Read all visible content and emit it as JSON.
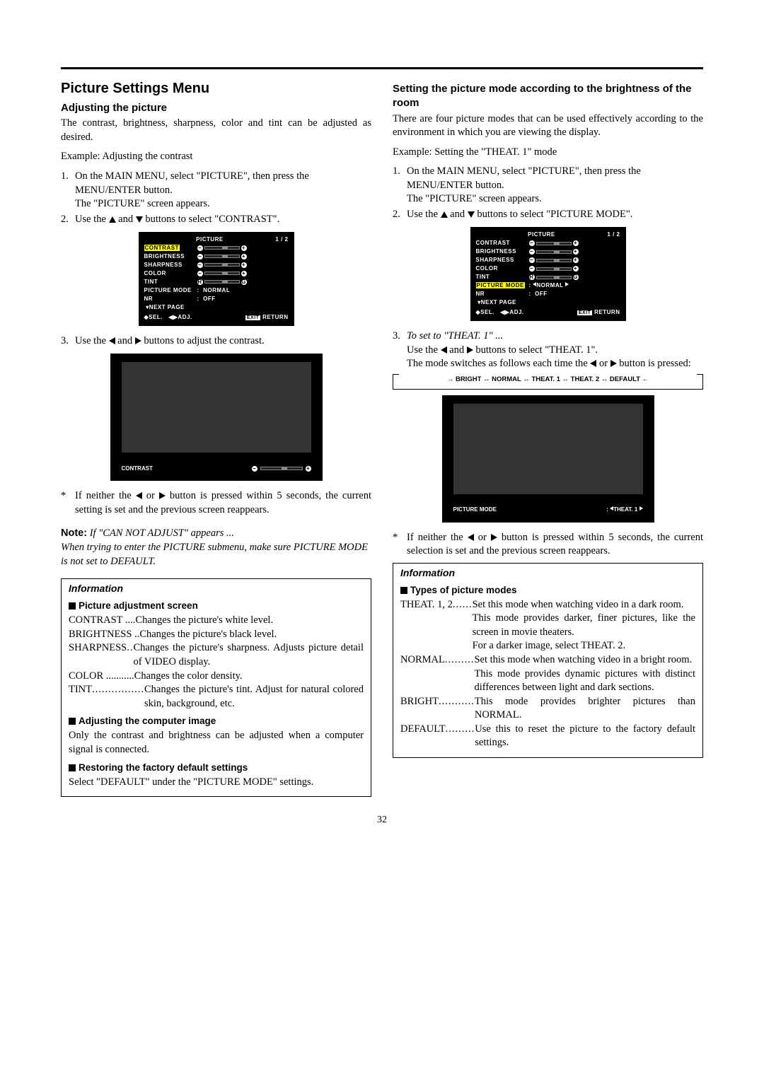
{
  "left": {
    "h1": "Picture Settings Menu",
    "h2": "Adjusting the picture",
    "intro": "The contrast, brightness, sharpness, color and tint can be adjusted as desired.",
    "example": "Example: Adjusting the contrast",
    "step1a": "On the MAIN MENU, select \"PICTURE\", then press the MENU/ENTER button.",
    "step1b": "The \"PICTURE\" screen appears.",
    "step2a": "Use the ",
    "step2b": " and ",
    "step2c": " buttons to select \"CONTRAST\".",
    "step3a": "Use the ",
    "step3b": " and ",
    "step3c": " buttons to adjust the contrast.",
    "asterisk": "If neither the ",
    "asterisk2": " or ",
    "asterisk3": " button is pressed within 5 seconds, the current setting is set and the previous screen reappears.",
    "noteTitle": "Note:",
    "note1": "If \"CAN NOT ADJUST\" appears ...",
    "note2": "When trying to enter the PICTURE submenu, make sure PICTURE MODE is not set to DEFAULT.",
    "info": {
      "h": "Information",
      "sub1": "Picture adjustment screen",
      "items": [
        {
          "t": "CONTRAST",
          "dots": " ....",
          "d": "Changes the picture's white level."
        },
        {
          "t": "BRIGHTNESS",
          "dots": " ..",
          "d": "Changes the picture's black level."
        },
        {
          "t": "SHARPNESS",
          "dots": " ..",
          "d": "Changes the picture's sharpness. Adjusts picture detail of VIDEO display."
        },
        {
          "t": "COLOR",
          "dots": " ...........",
          "d": "Changes the color density."
        },
        {
          "t": "TINT",
          "dots": " ................",
          "d": "Changes the picture's tint. Adjust for natural colored skin, background, etc."
        }
      ],
      "sub2": "Adjusting the computer image",
      "p2": "Only the contrast and brightness can be adjusted when a computer signal is connected.",
      "sub3": "Restoring the factory default settings",
      "p3": "Select \"DEFAULT\" under the \"PICTURE MODE\" settings."
    },
    "osd": {
      "title": "PICTURE",
      "pg": "1 / 2",
      "rows": [
        "CONTRAST",
        "BRIGHTNESS",
        "SHARPNESS",
        "COLOR",
        "TINT",
        "PICTURE MODE",
        "NR"
      ],
      "mode": "NORMAL",
      "nr": "OFF",
      "next": "NEXT PAGE",
      "sel": "SEL.",
      "adj": "ADJ.",
      "exit": "EXIT",
      "ret": "RETURN"
    },
    "prevLabel": "CONTRAST"
  },
  "right": {
    "h2": "Setting the picture mode according to the brightness of the room",
    "intro": "There are four picture modes that can be used effectively according to the environment in which you are viewing the display.",
    "example": "Example: Setting the \"THEAT. 1\" mode",
    "step1a": "On the MAIN MENU, select \"PICTURE\", then press the MENU/ENTER button.",
    "step1b": "The \"PICTURE\" screen appears.",
    "step2a": "Use the ",
    "step2b": " and ",
    "step2c": " buttons to select \"PICTURE MODE\".",
    "step3title": "To set to \"THEAT. 1\" ...",
    "step3a": "Use the ",
    "step3b": " and ",
    "step3c": " buttons to select \"THEAT. 1\".",
    "step3d": "The mode switches as follows each time the ",
    "step3e": " or ",
    "step3f": " button is pressed:",
    "cycle": "→ BRIGHT ↔ NORMAL ↔ THEAT. 1 ↔ THEAT. 2 ↔ DEFAULT ←",
    "asterisk": "If neither the ",
    "asterisk2": " or ",
    "asterisk3": " button is pressed within 5 seconds, the current selection is set and the previous screen reappears.",
    "prevLabel": "PICTURE MODE",
    "prevVal": "THEAT. 1",
    "info": {
      "h": "Information",
      "sub1": "Types of picture modes",
      "items": [
        {
          "t": "THEAT. 1, 2",
          "dots": " ......",
          "d": "Set this mode when watching video in a dark room.\nThis mode provides darker, finer pictures, like the screen in movie theaters.\nFor a darker image, select THEAT. 2."
        },
        {
          "t": "NORMAL",
          "dots": " .........",
          "d": "Set this mode when watching video in a bright room.\nThis mode provides dynamic pictures with distinct differences between light and dark sections."
        },
        {
          "t": "BRIGHT",
          "dots": " ...........",
          "d": "This mode provides brighter pictures than NORMAL."
        },
        {
          "t": "DEFAULT",
          "dots": " .........",
          "d": "Use this to reset the picture to the factory default settings."
        }
      ]
    }
  },
  "pageNum": "32"
}
